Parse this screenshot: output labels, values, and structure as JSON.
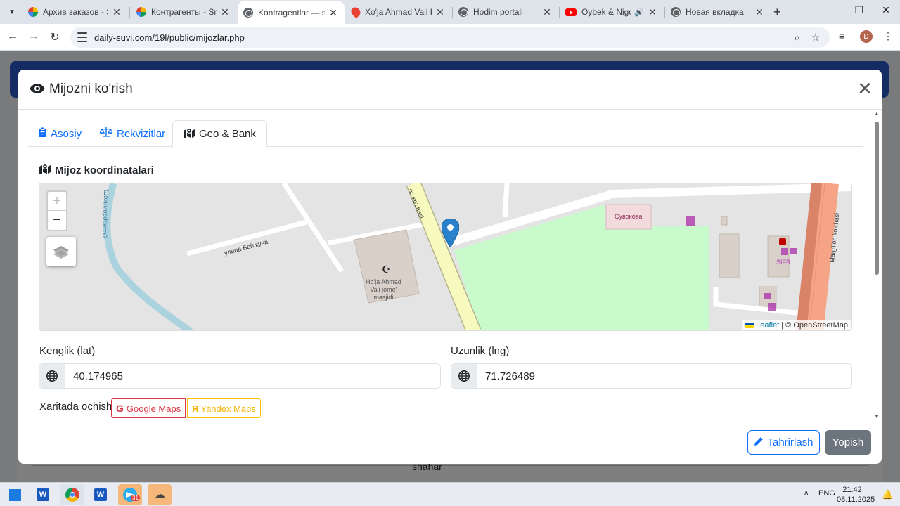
{
  "browser": {
    "tabs": [
      {
        "title": "Архив заказов - Sma",
        "favicon": "smart-icon",
        "active": false
      },
      {
        "title": "Контрагенты - Smart",
        "favicon": "smart-icon",
        "active": false
      },
      {
        "title": "Kontragentlar — stac",
        "favicon": "globe-icon",
        "active": true
      },
      {
        "title": "Xo'ja Ahmad Vali Kat",
        "favicon": "map-pin-icon",
        "active": false
      },
      {
        "title": "Hodim portali",
        "favicon": "globe-icon",
        "active": false
      },
      {
        "title": "Oybek & Nigora",
        "favicon": "youtube-icon",
        "active": false
      },
      {
        "title": "Новая вкладка",
        "favicon": "globe-icon",
        "active": false
      }
    ],
    "url": "daily-suvi.com/19l/public/mijozlar.php",
    "profile_initial": "D"
  },
  "background_page": {
    "cell_text": "shahar"
  },
  "modal": {
    "title": "Mijozni ko'rish",
    "tabs": [
      {
        "label": "Asosiy",
        "active": false
      },
      {
        "label": "Rekvizitlar",
        "active": false
      },
      {
        "label": "Geo & Bank",
        "active": true
      }
    ],
    "section_title": "Mijoz koordinatalari",
    "map": {
      "labels": {
        "street_top": "on ko'chasi",
        "street_bogo": "улица Бой куча",
        "canal": "Шохимордонсой",
        "mosque": [
          "Ho'ja Ahmad",
          "Vali jome'",
          "masjidi"
        ],
        "shop": "Сувокова",
        "sifr": "SIFR",
        "street_right": "Marg'ilon ko'chasi"
      },
      "attribution_leaflet": "Leaflet",
      "attribution_osm": "© OpenStreetMap",
      "zoom_in": "+",
      "zoom_out": "−"
    },
    "lat_label": "Kenglik (lat)",
    "lat_value": "40.174965",
    "lng_label": "Uzunlik (lng)",
    "lng_value": "71.726489",
    "open_in_map_label": "Xaritada ochish",
    "google_maps_label": "Google Maps",
    "yandex_maps_label": "Yandex Maps",
    "edit_button": "Tahrirlash",
    "close_button": "Yopish"
  },
  "taskbar": {
    "language": "ENG",
    "time": "21:42",
    "date": "08.11.2025",
    "telegram_badge": "31"
  },
  "colors": {
    "primary": "#0d6efd",
    "secondary": "#6c757d",
    "danger": "#dc3545",
    "warning": "#ffc107",
    "park": "#c8facc",
    "main_road": "#f7fabf",
    "trunk_road": "#f6a487"
  }
}
